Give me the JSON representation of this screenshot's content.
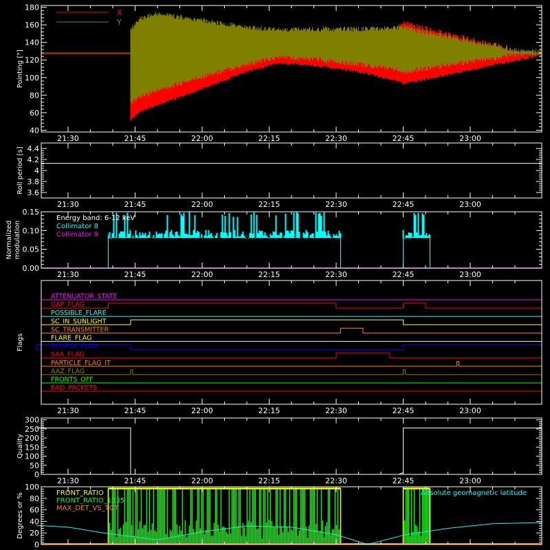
{
  "colors": {
    "background": "#000000",
    "axes": "#ffffff",
    "x_series": "#ff0000",
    "y_series": "#808000",
    "collimator8": "#00ffff",
    "collimator9": "#ff00ff",
    "front_ratio": "#ffff00",
    "front_ratio_1035": "#00ff00",
    "max_det_vs_tot": "#ff8000",
    "geomag": "#00ffff"
  },
  "time_ticks": [
    "21:30",
    "21:45",
    "22:00",
    "22:15",
    "22:30",
    "22:45",
    "23:00"
  ],
  "chart_data": [
    {
      "type": "line",
      "panel": "pointing",
      "ylabel": "Pointing [\"]",
      "xlim": [
        "21:24",
        "23:16"
      ],
      "ylim": [
        38,
        182
      ],
      "yticks": [
        40,
        60,
        80,
        100,
        120,
        140,
        160,
        180
      ],
      "legend": {
        "position": "top-left"
      },
      "series": [
        {
          "name": "X",
          "color": "#ff0000",
          "x": [
            "21:23",
            "21:44",
            "21:44",
            "21:46",
            "21:50",
            "22:00",
            "22:10",
            "22:17",
            "22:25",
            "22:35",
            "22:44",
            "22:45",
            "23:16"
          ],
          "y_low": [
            127,
            127,
            53,
            62,
            70,
            88,
            108,
            118,
            115,
            108,
            97,
            94,
            127
          ],
          "y_high": [
            127,
            127,
            158,
            168,
            172,
            164,
            160,
            158,
            158,
            158,
            160,
            165,
            127
          ]
        },
        {
          "name": "Y",
          "color": "#808000",
          "x": [
            "21:23",
            "21:44",
            "21:44",
            "21:46",
            "21:50",
            "22:00",
            "22:10",
            "22:17",
            "22:25",
            "22:35",
            "22:44",
            "22:45",
            "23:16"
          ],
          "y_low": [
            128,
            128,
            68,
            75,
            82,
            98,
            112,
            120,
            118,
            112,
            106,
            103,
            128
          ],
          "y_high": [
            128,
            128,
            158,
            170,
            176,
            168,
            160,
            158,
            158,
            158,
            160,
            160,
            128
          ]
        }
      ]
    },
    {
      "type": "line",
      "panel": "roll_period",
      "ylabel": "Roll period [s]",
      "xlim": [
        "21:24",
        "23:16"
      ],
      "ylim": [
        3.5,
        4.5
      ],
      "yticks": [
        3.6,
        3.8,
        4.0,
        4.2,
        4.4
      ],
      "series": [
        {
          "color": "#ffffff",
          "x": [
            "21:23",
            "23:16"
          ],
          "y": [
            4.13,
            4.13
          ]
        }
      ]
    },
    {
      "type": "line",
      "panel": "modulation",
      "ylabel": "Normalized\nmodulation",
      "xlim": [
        "21:24",
        "23:16"
      ],
      "ylim": [
        0,
        0.15
      ],
      "yticks": [
        0,
        0.05,
        0.1,
        0.15
      ],
      "yticklabels": [
        "0.00",
        "0.05",
        "0.10",
        "0.15"
      ],
      "annotation": "Energy band: 6-12 keV",
      "legend": {
        "position": "top-left"
      },
      "series": [
        {
          "name": "Collimator 8",
          "color": "#00ffff",
          "segments": [
            [
              "21:39",
              "22:31"
            ],
            [
              "22:45",
              "22:51"
            ]
          ],
          "base": 0.09,
          "peak": 0.15
        },
        {
          "name": "Collimator 9",
          "color": "#ff00ff",
          "x": [
            "21:23",
            "23:16"
          ],
          "y": [
            0,
            0
          ]
        }
      ]
    },
    {
      "type": "line",
      "panel": "flags",
      "ylabel": "Flags",
      "xlim": [
        "21:24",
        "23:16"
      ],
      "flags": [
        {
          "name": "ATTENUATOR_STATE",
          "color": "#ff00ff",
          "steps": []
        },
        {
          "name": "GAP_FLAG",
          "color": "#ff0000",
          "steps": [
            [
              "21:39",
              "22:30"
            ],
            [
              "22:45",
              "22:50"
            ]
          ]
        },
        {
          "name": "POSSIBLE_FLARE",
          "color": "#00ffff",
          "steps": []
        },
        {
          "name": "SC_IN_SUNLIGHT",
          "color": "#ffff00",
          "steps": [
            [
              "21:44",
              "22:45"
            ]
          ]
        },
        {
          "name": "SC_TRANSMITTER",
          "color": "#ff8000",
          "steps": [
            [
              "22:31",
              "22:36"
            ]
          ]
        },
        {
          "name": "FLARE_FLAG",
          "color": "#ffff00",
          "steps": []
        },
        {
          "name": "ECLIPSE_FLAG",
          "color": "#0000ff",
          "steps": [
            [
              "21:23",
              "21:44"
            ],
            [
              "22:45",
              "23:16"
            ]
          ]
        },
        {
          "name": "SAA_FLAG",
          "color": "#ff0000",
          "steps": [
            [
              "22:30",
              "22:42"
            ]
          ]
        },
        {
          "name": "PARTICLE_FLAG_IT",
          "color": "#ff8000",
          "steps": [
            [
              "22:57",
              "22:57"
            ]
          ]
        },
        {
          "name": "AAZ_FLAG",
          "color": "#808000",
          "steps": [
            [
              "21:44",
              "21:44"
            ],
            [
              "22:45",
              "22:45"
            ]
          ]
        },
        {
          "name": "FRONTS_OFF",
          "color": "#00ff00",
          "steps": []
        },
        {
          "name": "BAD_PACKETS",
          "color": "#ff0000",
          "steps": []
        }
      ]
    },
    {
      "type": "line",
      "panel": "quality",
      "ylabel": "Quality",
      "xlim": [
        "21:24",
        "23:16"
      ],
      "ylim": [
        0,
        310
      ],
      "yticks": [
        0,
        50,
        100,
        150,
        200,
        250,
        300
      ],
      "series": [
        {
          "color": "#ffffff",
          "x": [
            "21:23",
            "21:40",
            "21:44",
            "21:44",
            "22:44",
            "22:45",
            "22:45",
            "23:16"
          ],
          "y": [
            255,
            255,
            255,
            0,
            0,
            10,
            255,
            255
          ]
        }
      ]
    },
    {
      "type": "line",
      "panel": "ratios",
      "ylabel": "Degrees or %",
      "xlim": [
        "21:24",
        "23:16"
      ],
      "ylim": [
        0,
        100
      ],
      "yticks": [
        0,
        20,
        40,
        60,
        80,
        100
      ],
      "legend": {
        "position": "top-left"
      },
      "series": [
        {
          "name": "FRONT_RATIO",
          "color": "#ffff00",
          "segments": [
            [
              "21:39",
              "22:31"
            ],
            [
              "22:45",
              "22:51"
            ]
          ],
          "value": 97
        },
        {
          "name": "FRONT_RATIO_1035",
          "color": "#00ff00",
          "segments": [
            [
              "21:39",
              "22:31"
            ],
            [
              "22:45",
              "22:51"
            ]
          ],
          "range": [
            10,
            97
          ]
        },
        {
          "name": "MAX_DET_VS_TOT",
          "color": "#ff8000",
          "value": 0
        },
        {
          "name": "Absolute geomagnetic latitude",
          "color": "#00ffff",
          "x": [
            "21:23",
            "21:30",
            "21:38",
            "21:50",
            "22:00",
            "22:10",
            "22:20",
            "22:30",
            "22:37",
            "22:45",
            "22:55",
            "23:05",
            "23:16"
          ],
          "y": [
            33,
            30,
            20,
            8,
            22,
            32,
            30,
            17,
            0,
            16,
            28,
            36,
            38
          ]
        }
      ]
    }
  ]
}
